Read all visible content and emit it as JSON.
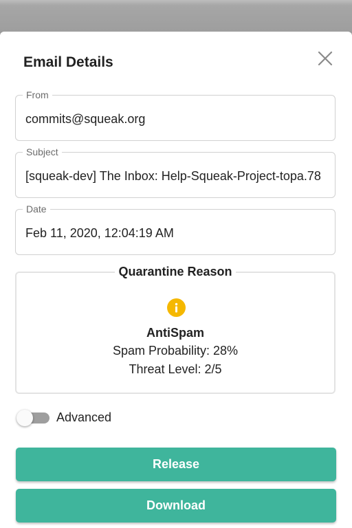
{
  "dialog": {
    "title": "Email Details",
    "close_icon": "close-icon"
  },
  "fields": {
    "from": {
      "label": "From",
      "value": "commits@squeak.org"
    },
    "subject": {
      "label": "Subject",
      "value": "[squeak-dev] The Inbox: Help-Squeak-Project-topa.78"
    },
    "date": {
      "label": "Date",
      "value": "Feb 11, 2020, 12:04:19 AM"
    }
  },
  "quarantine": {
    "title": "Quarantine Reason",
    "icon": "info-icon",
    "icon_color": "#f5b800",
    "reason": "AntiSpam",
    "spam_probability": "Spam Probability: 28%",
    "threat_level": "Threat Level: 2/5"
  },
  "advanced": {
    "label": "Advanced",
    "enabled": false
  },
  "actions": {
    "release_label": "Release",
    "download_label": "Download",
    "button_color": "#3fb59c"
  }
}
